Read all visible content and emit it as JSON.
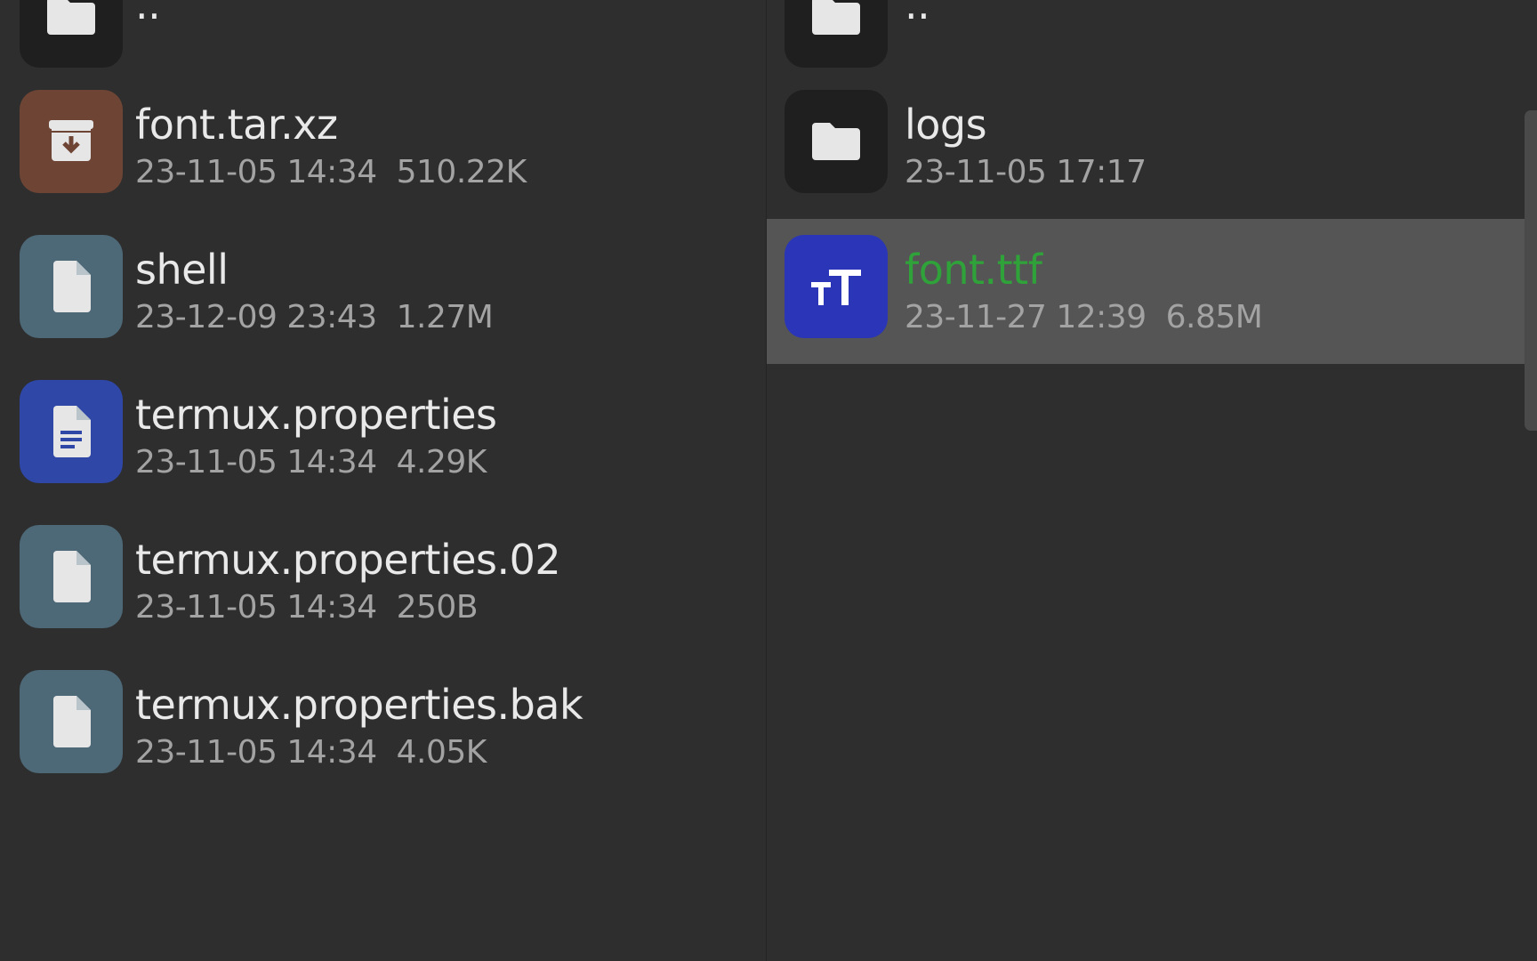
{
  "left_pane": {
    "parent": {
      "name": "..",
      "icon": "folder-icon",
      "color": "#1f1f1f"
    },
    "items": [
      {
        "name": "font.tar.xz",
        "date": "23-11-05 14:34",
        "size": "510.22K",
        "icon": "archive-icon",
        "color": "#6e4535"
      },
      {
        "name": "shell",
        "date": "23-12-09 23:43",
        "size": "1.27M",
        "icon": "file-icon",
        "color": "#4d6877"
      },
      {
        "name": "termux.properties",
        "date": "23-11-05 14:34",
        "size": "4.29K",
        "icon": "text-file-icon",
        "color": "#2f47a6"
      },
      {
        "name": "termux.properties.02",
        "date": "23-11-05 14:34",
        "size": "250B",
        "icon": "file-icon",
        "color": "#4d6877"
      },
      {
        "name": "termux.properties.bak",
        "date": "23-11-05 14:34",
        "size": "4.05K",
        "icon": "file-icon",
        "color": "#4d6877"
      }
    ]
  },
  "right_pane": {
    "parent": {
      "name": "..",
      "icon": "folder-icon",
      "color": "#1f1f1f"
    },
    "items": [
      {
        "name": "logs",
        "date": "23-11-05 17:17",
        "size": "",
        "icon": "folder-icon",
        "color": "#1f1f1f"
      },
      {
        "name": "font.ttf",
        "date": "23-11-27 12:39",
        "size": "6.85M",
        "icon": "font-icon",
        "color": "#2a35b8",
        "selected": true,
        "name_color": "#2fa33a"
      }
    ]
  }
}
